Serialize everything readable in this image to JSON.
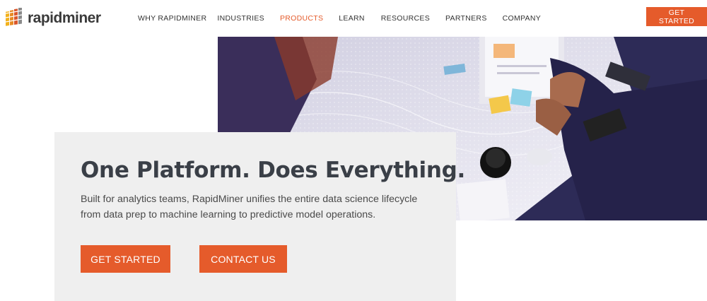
{
  "header": {
    "logo_text": "rapidminer",
    "nav": [
      {
        "label": "WHY RAPIDMINER"
      },
      {
        "label": "INDUSTRIES"
      },
      {
        "label": "PRODUCTS",
        "active": true
      },
      {
        "label": "LEARN"
      },
      {
        "label": "RESOURCES"
      },
      {
        "label": "PARTNERS"
      },
      {
        "label": "COMPANY"
      }
    ],
    "cta_label": "GET STARTED"
  },
  "hero": {
    "headline": "One Platform. Does Everything.",
    "description": "Built for analytics teams, RapidMiner unifies the entire data science lifecycle from data prep to machine learning to predictive model operations.",
    "primary_button": "GET STARTED",
    "secondary_button": "CONTACT US"
  },
  "colors": {
    "accent": "#e55b2b",
    "active_nav": "#e55b2b",
    "card_bg": "#efefef",
    "hero_bg": "#2d2b57"
  }
}
